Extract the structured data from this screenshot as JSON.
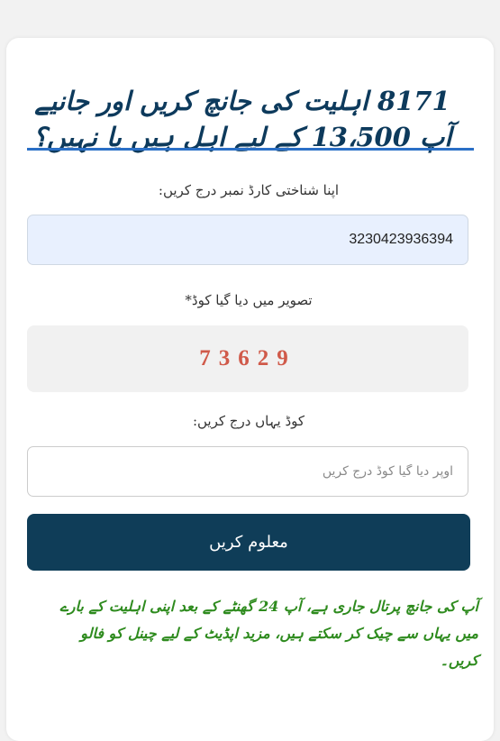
{
  "header": {
    "title": "8171 اہلیت کی جانچ کریں اور جانیے آپ 13،500 کے لیے اہل ہیں یا نہیں؟"
  },
  "form": {
    "cnic_label": "اپنا شناختی کارڈ نمبر درج کریں:",
    "cnic_value": "3230423936394",
    "captcha_label": "تصویر میں دیا گیا کوڈ*",
    "captcha_code": "73629",
    "code_label": "کوڈ یہاں درج کریں:",
    "code_placeholder": "اوپر دیا گیا کوڈ درج کریں",
    "submit_label": "معلوم کریں"
  },
  "notice": {
    "text": "آپ کی جانچ پرتال جاری ہے، آپ 24 گھنٹے کے بعد اپنی اہلیت کے بارے میں یہاں سے چیک کر سکتے ہیں، مزید اپڈیٹ کے لیے چینل کو فالو کریں۔"
  },
  "colors": {
    "title": "#0d3a5c",
    "accent_line": "#2a6fc6",
    "button": "#0f3d58",
    "captcha_text": "#d05a4a",
    "notice_text": "#2e8b1e"
  }
}
